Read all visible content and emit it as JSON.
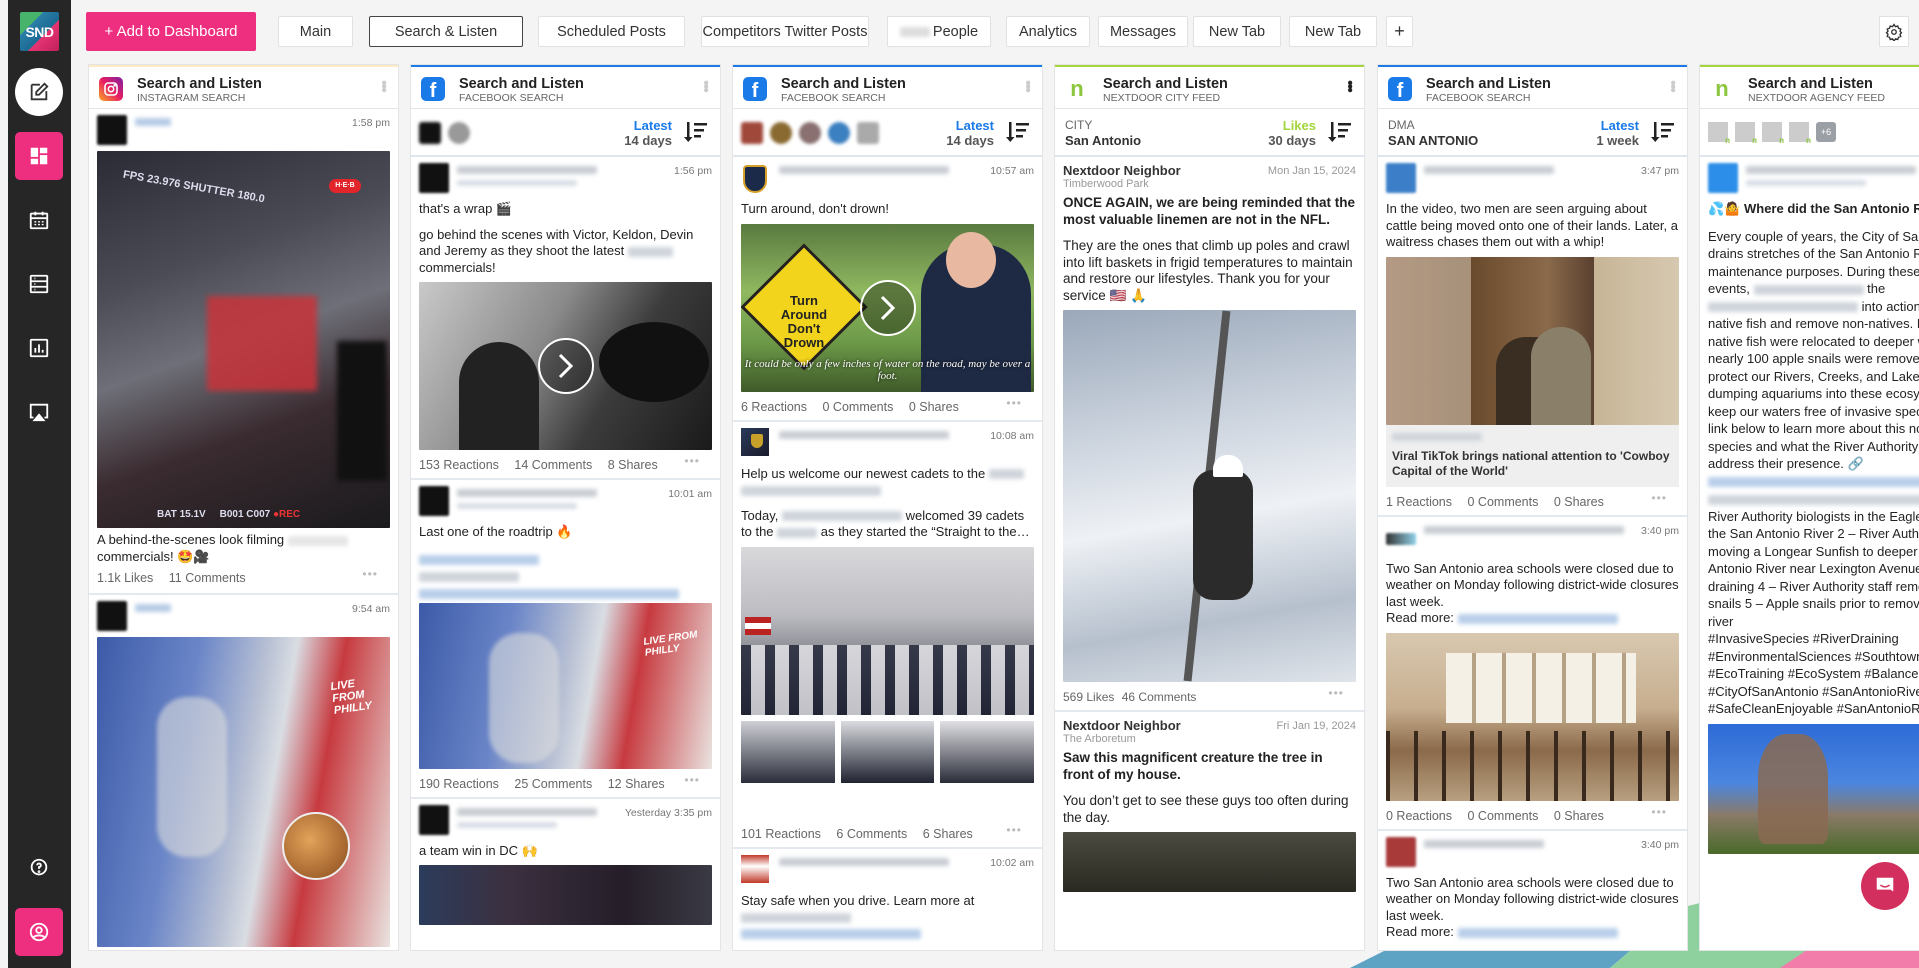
{
  "app": {
    "logo_text": "SND",
    "accent_color": "#ee2f7f",
    "facebook_color": "#1a7ae8",
    "nextdoor_color": "#a3d53c"
  },
  "sidebar": {
    "items": [
      {
        "name": "compose",
        "icon": "edit-icon"
      },
      {
        "name": "dashboard",
        "icon": "dashboard-icon",
        "active": true
      },
      {
        "name": "calendar",
        "icon": "calendar-icon"
      },
      {
        "name": "list",
        "icon": "list-icon"
      },
      {
        "name": "analytics",
        "icon": "bar-chart-icon"
      },
      {
        "name": "cast",
        "icon": "airplay-icon"
      }
    ],
    "bottom": [
      {
        "name": "help",
        "icon": "help-icon"
      },
      {
        "name": "profile",
        "icon": "user-icon"
      }
    ]
  },
  "toolbar": {
    "add_label": "+ Add to Dashboard",
    "tabs": [
      {
        "label": "Main"
      },
      {
        "label": "Search & Listen",
        "active": true
      },
      {
        "label": "Scheduled Posts"
      },
      {
        "label": "Competitors Twitter Posts"
      },
      {
        "label": "People",
        "prefix_redacted": true
      },
      {
        "label": "Analytics"
      },
      {
        "label": "Messages"
      },
      {
        "label": "New Tab"
      },
      {
        "label": "New Tab"
      }
    ],
    "add_tab_label": "+"
  },
  "columns": [
    {
      "title": "Search and Listen",
      "subtitle": "INSTAGRAM SEARCH",
      "network": "instagram",
      "posts": [
        {
          "time": "1:58 pm",
          "text": "A behind-the-scenes look filming",
          "text_tail": "commercials! 🤩🎥",
          "likes": "1.1k Likes",
          "comments": "11 Comments"
        },
        {
          "time": "9:54 am"
        }
      ]
    },
    {
      "title": "Search and Listen",
      "subtitle": "FACEBOOK SEARCH",
      "network": "facebook",
      "sort": {
        "label": "Latest",
        "period": "14 days"
      },
      "posts": [
        {
          "time": "1:56 pm",
          "text1": "that's a wrap 🎬",
          "text2": "go behind the scenes with Victor, Keldon, Devin and Jeremy as they shoot the latest",
          "text3": "commercials!",
          "reactions": "153 Reactions",
          "comments": "14 Comments",
          "shares": "8 Shares"
        },
        {
          "time": "10:01 am",
          "text1": "Last one of the roadtrip 🔥",
          "reactions": "190 Reactions",
          "comments": "25 Comments",
          "shares": "12 Shares"
        },
        {
          "time": "Yesterday 3:35 pm",
          "text1": "a team win in DC 🙌"
        }
      ]
    },
    {
      "title": "Search and Listen",
      "subtitle": "FACEBOOK SEARCH",
      "network": "facebook",
      "sort": {
        "label": "Latest",
        "period": "14 days"
      },
      "posts": [
        {
          "time": "10:57 am",
          "text1": "Turn around, don't drown!",
          "img_caption": "It could be only a few inches of water on the road, may be over a foot.",
          "sign_text": "Turn Around Don't Drown",
          "reactions": "6 Reactions",
          "comments": "0 Comments",
          "shares": "0 Shares"
        },
        {
          "time": "10:08 am",
          "text1": "Help us welcome our newest cadets to the",
          "text2a": "Today,",
          "text2b": "welcomed 39 cadets to the",
          "text2c": "as they started the “Straight to the…",
          "reactions": "101 Reactions",
          "comments": "6 Comments",
          "shares": "6 Shares"
        },
        {
          "time": "10:02 am",
          "text1": "Stay safe when you drive. Learn more at"
        }
      ]
    },
    {
      "title": "Search and Listen",
      "subtitle": "NEXTDOOR CITY FEED",
      "network": "nextdoor",
      "filter": {
        "key": "CITY",
        "value": "San Antonio"
      },
      "sort": {
        "label": "Likes",
        "period": "30 days"
      },
      "posts": [
        {
          "author": "Nextdoor Neighbor",
          "location": "Timberwood Park",
          "date": "Mon Jan 15, 2024",
          "headline": "ONCE AGAIN, we are being reminded that the most valuable linemen are not in the NFL.",
          "body": "They are the ones that climb up poles and crawl into lift baskets in frigid temperatures to maintain and restore our lifestyles. Thank you for your service 🇺🇸 🙏",
          "likes": "569 Likes",
          "comments": "46 Comments"
        },
        {
          "author": "Nextdoor Neighbor",
          "location": "The Arboretum",
          "date": "Fri Jan 19, 2024",
          "headline": "Saw this magnificent creature the tree in front of my house.",
          "body": "You don’t get to see these guys too often during the day."
        }
      ]
    },
    {
      "title": "Search and Listen",
      "subtitle": "FACEBOOK SEARCH",
      "network": "facebook",
      "filter": {
        "key": "DMA",
        "value": "SAN ANTONIO"
      },
      "sort": {
        "label": "Latest",
        "period": "1 week"
      },
      "posts": [
        {
          "time": "3:47 pm",
          "text1": "In the video, two men are seen arguing about cattle being moved onto one of their lands. Later, a waitress chases them out with a whip!",
          "link_title": "Viral TikTok brings national attention to 'Cowboy Capital of the World'",
          "reactions": "1 Reactions",
          "comments": "0 Comments",
          "shares": "0 Shares"
        },
        {
          "time": "3:40 pm",
          "text1": "Two San Antonio area schools were closed due to weather on Monday following district-wide closures last week.",
          "read_more": "Read more:",
          "reactions": "0 Reactions",
          "comments": "0 Comments",
          "shares": "0 Shares"
        },
        {
          "time": "3:40 pm",
          "text1": "Two San Antonio area schools were closed due to weather on Monday following district-wide closures last week.",
          "read_more": "Read more:"
        }
      ]
    },
    {
      "title": "Search and Listen",
      "subtitle": "NEXTDOOR AGENCY FEED",
      "network": "nextdoor",
      "more_count": "+6",
      "posts": [
        {
          "headline": "💦🤷 Where did the San Antonio River go?!?!",
          "body1": "Every couple of years, the City of San Antonio drains stretches of the San Antonio River for maintenance purposes. During these draining events,",
          "body2": "the",
          "body3": "into action to relocate native fish and remove non-natives. Dozens of native fish were relocated to deeper water and nearly 100 apple snails were removed! 🚫🐌 let's protect our Rivers, Creeks, and Lakes by not dumping aquariums into these ecosystems. Help us keep our waters free of invasive species! -Click the link below to learn more about this non-native species and what the River Authority is doing to address their presence. 🔗",
          "body4": "River Authority biologists in the Eagleland stretch of the San Antonio River 2 – River Authority staff moving a Longear Sunfish to deeper water 3 – San Antonio River near Lexington Avenue during 2024 draining 4 – River Authority staff removing apple snails 5 – Apple snails prior to removal from the river",
          "hashtags": "#InvasiveSpecies #RiverDraining #EnvironmentalSciences #SouthtownSanAntonio #EcoTraining #EcoSystem #Balance #RiverLife #CityOfSanAntonio #SanAntonioRiver #SafeCleanEnjoyable #SanAntonioRiverAuthority"
        }
      ]
    }
  ]
}
